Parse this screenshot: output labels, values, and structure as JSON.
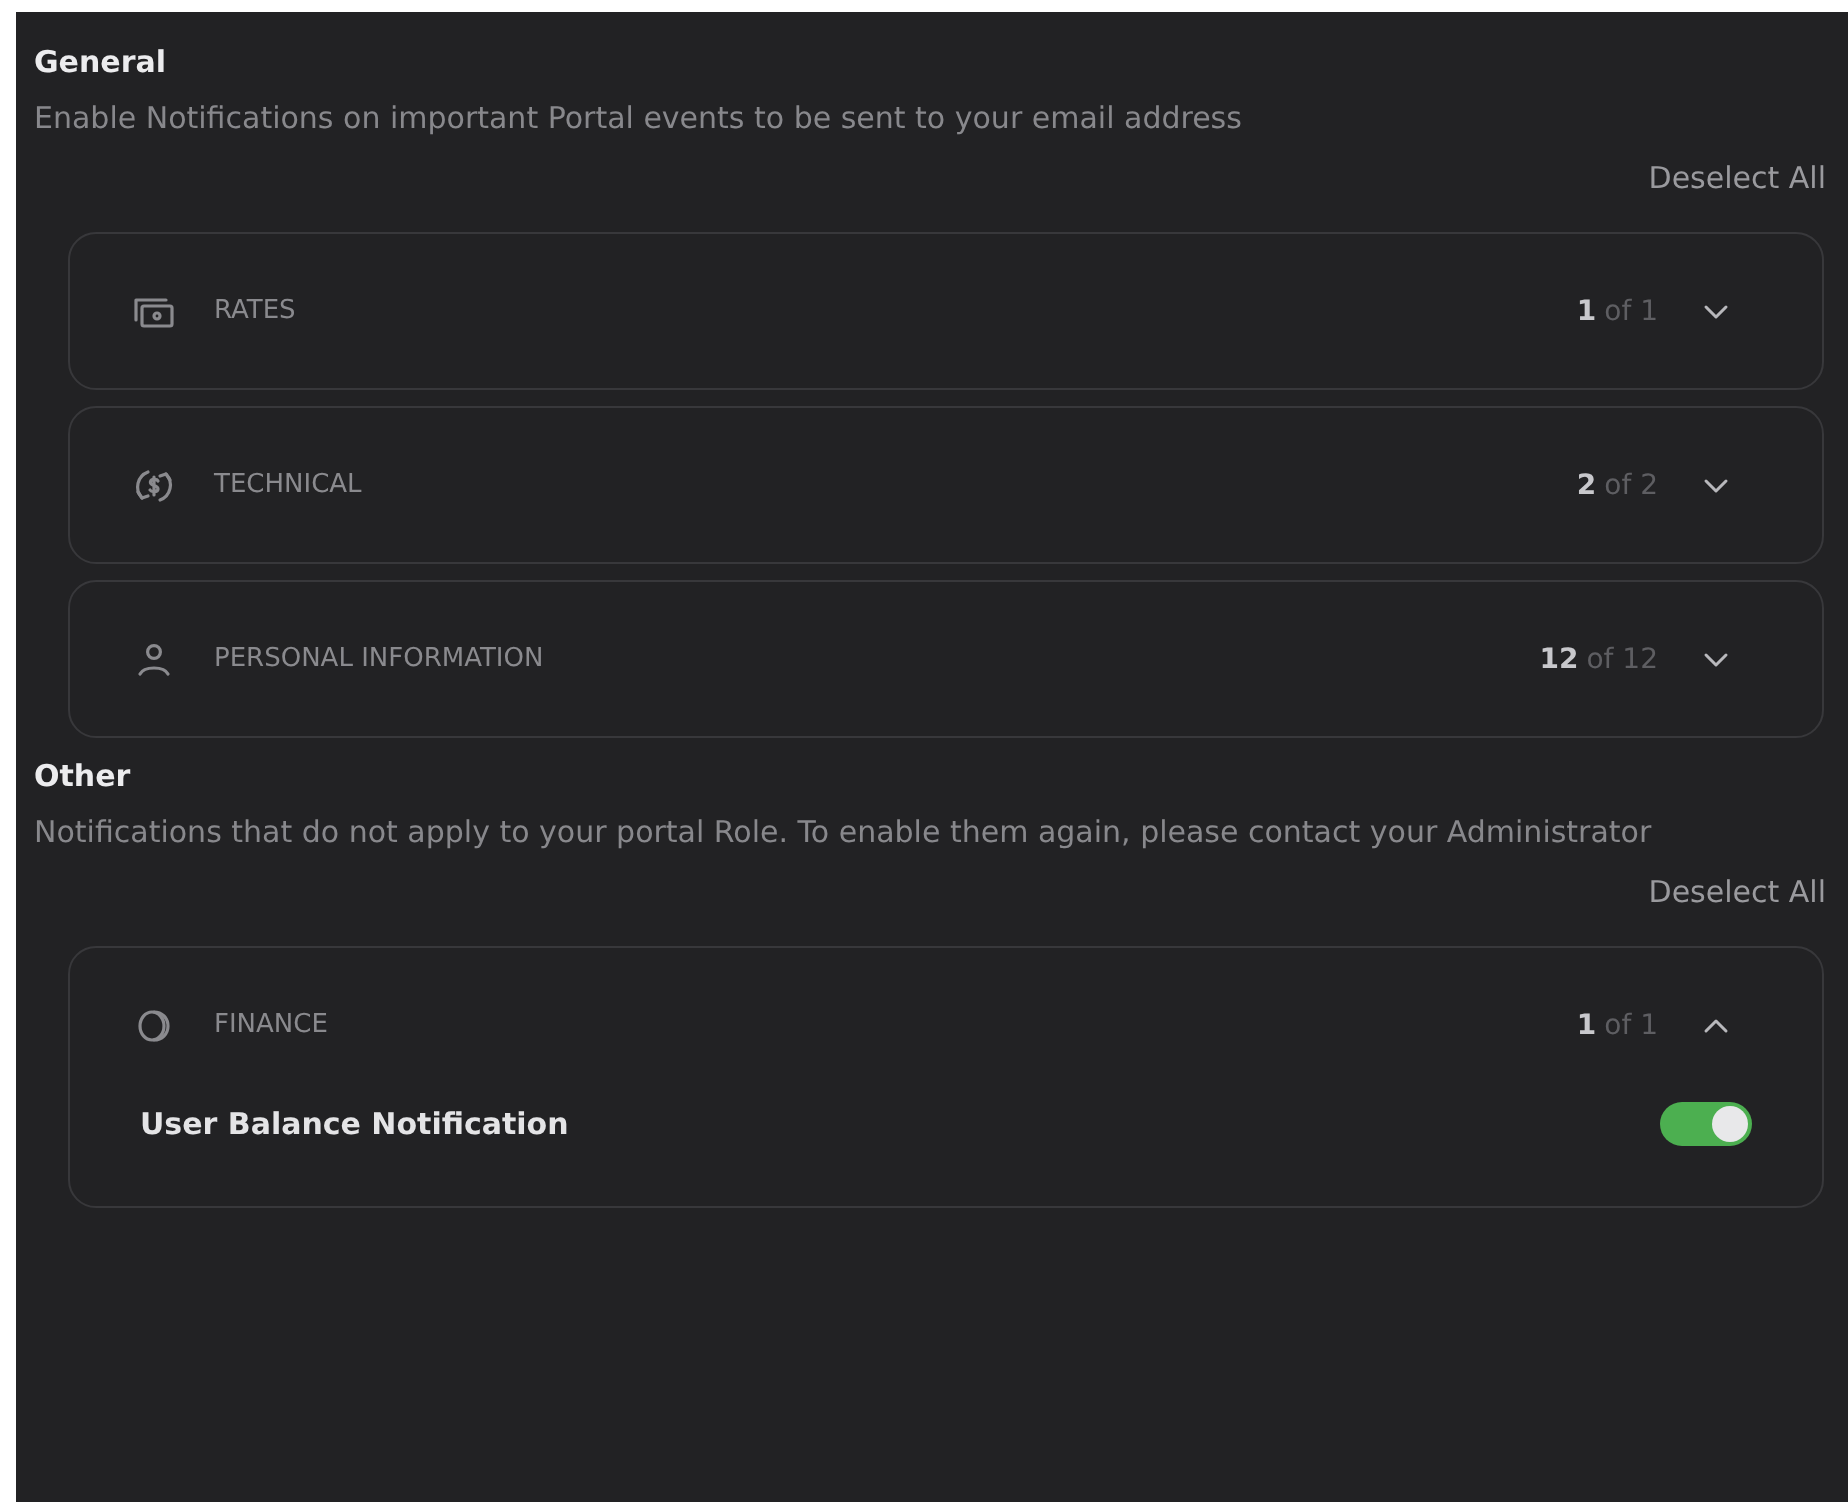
{
  "sections": [
    {
      "title": "General",
      "description": "Enable Notifications on important Portal events to be sent to your email address",
      "action": "Deselect All",
      "groups": [
        {
          "label": "RATES",
          "count": "1",
          "total": "of 1",
          "expanded": false
        },
        {
          "label": "TECHNICAL",
          "count": "2",
          "total": "of 2",
          "expanded": false
        },
        {
          "label": "PERSONAL INFORMATION",
          "count": "12",
          "total": "of 12",
          "expanded": false
        }
      ]
    },
    {
      "title": "Other",
      "description": "Notifications that do not apply to your portal Role. To enable them again, please contact your Administrator",
      "action": "Deselect All",
      "groups": [
        {
          "label": "FINANCE",
          "count": "1",
          "total": "of 1",
          "expanded": true,
          "items": [
            {
              "label": "User Balance Notification",
              "on": true
            }
          ]
        }
      ]
    }
  ]
}
